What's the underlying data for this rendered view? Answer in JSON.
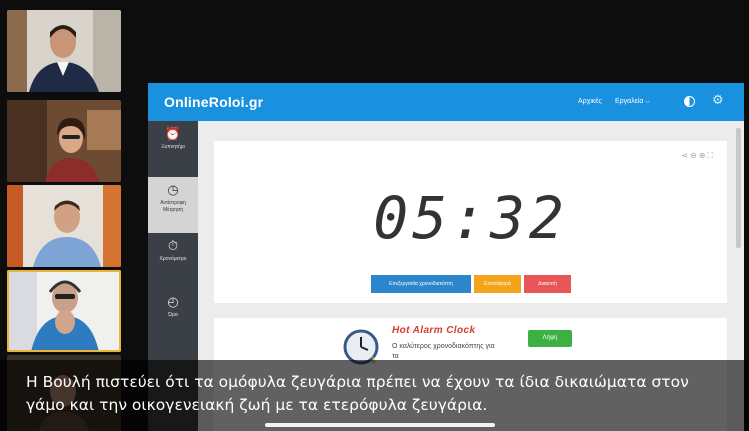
{
  "site": {
    "logo": "OnlineRoloi.gr",
    "nav_home": "Αρχικές",
    "nav_tools": "Εργαλεία",
    "nav_caret": "⌵"
  },
  "sidebar": {
    "items": [
      {
        "icon": "alarm-clock-icon",
        "label": "Ξυπνητήρι"
      },
      {
        "icon": "countdown-icon",
        "label": "Αντίστροφη Μέτρηση"
      },
      {
        "icon": "stopwatch-icon",
        "label": "Χρονόμετρο"
      },
      {
        "icon": "clock-icon",
        "label": "Ώρα"
      }
    ]
  },
  "timer": {
    "display": "05:32",
    "tools": "⋖⊖⊕⛶"
  },
  "buttons": {
    "edit_timer": "Επεξεργασία χρονοδιακόπτη",
    "pause": "Επανάφορά",
    "reset": "Διακοπή"
  },
  "ad": {
    "title": "Hot Alarm Clock",
    "description": "Ο καλύτερος χρονοδιακόπτης για τα",
    "download": "Λήψη"
  },
  "caption": {
    "line1": "Η Βουλή πιστεύει ότι τα ομόφυλα ζευγάρια πρέπει να έχουν τα ίδια δικαιώματα στον",
    "line2": "γάμο και την οικογενειακή ζωή με τα ετερόφυλα ζευγάρια."
  },
  "colors": {
    "brand_blue": "#1a91df",
    "sidebar_dark": "#3b3f46",
    "edit_button": "#2c86cc",
    "pause_button": "#f3a41b",
    "reset_button": "#e85556",
    "download_button": "#3cb043",
    "active_speaker": "#e8b53a"
  }
}
